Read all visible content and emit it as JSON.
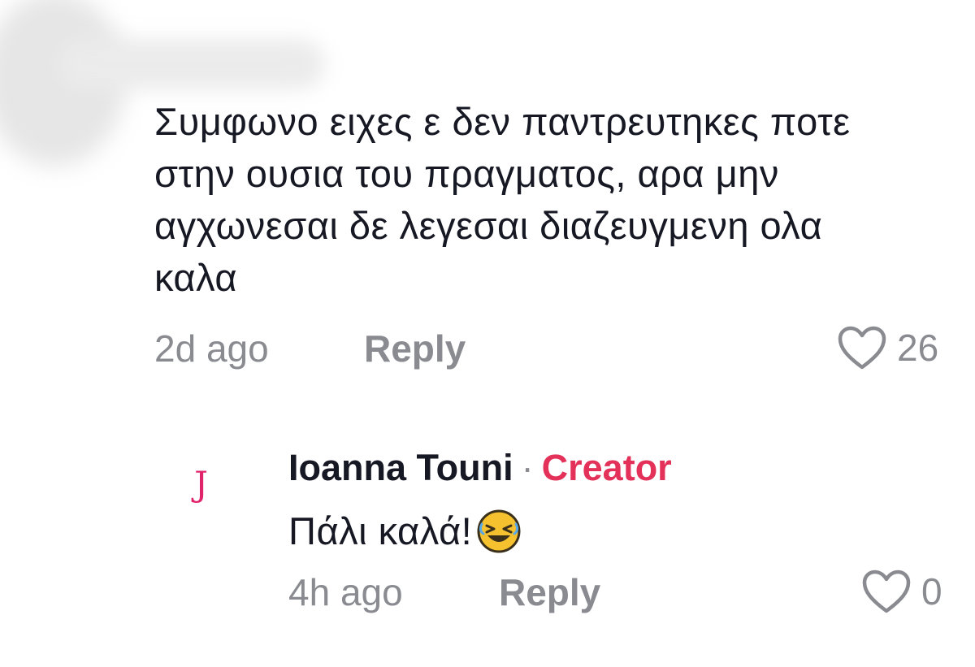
{
  "main_comment": {
    "text": "Συμφωνο ειχες ε δεν παντρευτηκες ποτε\nστην ουσια του πραγματος, αρα μην\nαγχωνεσαι δε λεγεσαι διαζευγμενη ολα\nκαλα",
    "time": "2d ago",
    "reply_label": "Reply",
    "like_count": "26",
    "like_icon": "heart-outline-icon"
  },
  "reply_comment": {
    "avatar_letter": "J",
    "author": "Ioanna Touni",
    "separator": "·",
    "badge": "Creator",
    "text": "Πάλι καλά!",
    "emoji": "rolling-on-floor-laughing-emoji",
    "time": "4h ago",
    "reply_label": "Reply",
    "like_count": "0",
    "like_icon": "heart-outline-icon"
  },
  "colors": {
    "text_primary": "#161823",
    "text_secondary": "#8a8b91",
    "creator_badge": "#e33159",
    "avatar_letter": "#e0246c"
  }
}
